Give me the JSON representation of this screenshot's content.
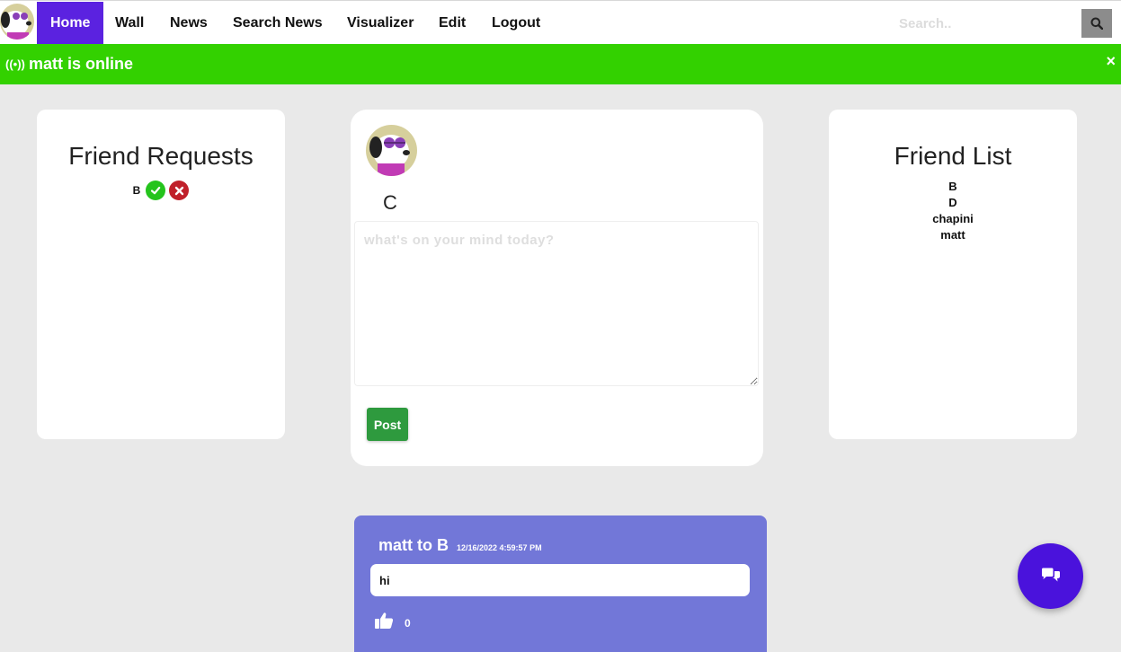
{
  "nav": {
    "links": [
      "Home",
      "Wall",
      "News",
      "Search News",
      "Visualizer",
      "Edit",
      "Logout"
    ],
    "active": "Home",
    "search_placeholder": "Search..",
    "accent_color": "#5b22e0"
  },
  "banner": {
    "icon": "broadcast-icon",
    "text": "matt is online",
    "close": "×",
    "color": "#33d100"
  },
  "requests": {
    "title": "Friend Requests",
    "items": [
      {
        "name": "B"
      }
    ]
  },
  "composer": {
    "username": "C",
    "placeholder": "what's on your mind today?",
    "post_label": "Post"
  },
  "friends": {
    "title": "Friend List",
    "items": [
      "B",
      "D",
      "chapini",
      "matt"
    ]
  },
  "feed": [
    {
      "title": "matt to B",
      "time": "12/16/2022 4:59:57 PM",
      "body": "hi",
      "likes": "0"
    }
  ],
  "chat": {
    "icon": "chat-icon",
    "color": "#4a12dc"
  }
}
